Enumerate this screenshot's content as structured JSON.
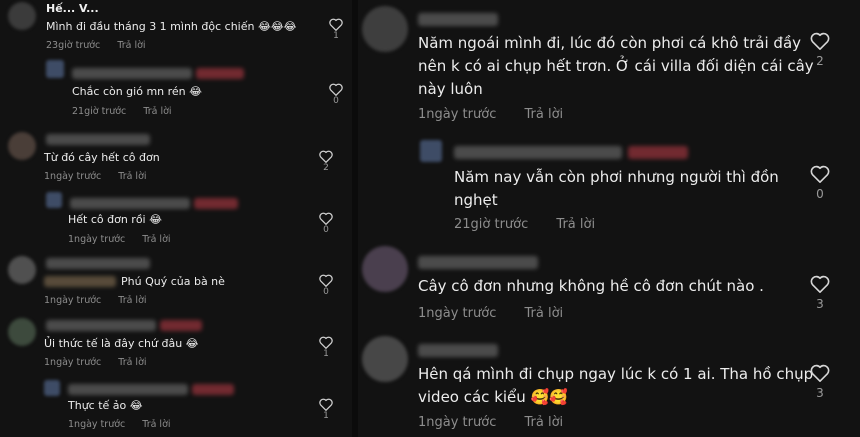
{
  "left": {
    "top_name": "Hế... V...",
    "comments": [
      {
        "text": "Mình đi đầu tháng 3 1 mình độc chiến 😂😂😂",
        "time": "23giờ trước",
        "reply": "Trả lời",
        "likes": "1"
      },
      {
        "text": "Chắc còn gió mn rén 😂",
        "time": "21giờ trước",
        "reply": "Trả lời",
        "likes": "0"
      },
      {
        "text": "Từ đó cây hết cô đơn",
        "time": "1ngày trước",
        "reply": "Trả lời",
        "likes": "2"
      },
      {
        "text": "Hết cô đơn rồi 😂",
        "time": "1ngày trước",
        "reply": "Trả lời",
        "likes": "0"
      },
      {
        "text": "Phú Quý của bà nè",
        "time": "1ngày trước",
        "reply": "Trả lời",
        "likes": "0"
      },
      {
        "text": "Ủi thức tế là đây chứ đâu 😂",
        "time": "1ngày trước",
        "reply": "Trả lời",
        "likes": "1"
      },
      {
        "text": "Thực tế ảo 😂",
        "time": "1ngày trước",
        "reply": "Trả lời",
        "likes": "1"
      }
    ]
  },
  "right": {
    "comments": [
      {
        "line1": "Năm ngoái mình đi, lúc đó còn phơi cá khô trải đầy",
        "line2": "nên k có ai chụp hết trơn. Ở cái villa đối diện cái cây",
        "line3": "này luôn",
        "time": "1ngày trước",
        "reply": "Trả lời",
        "likes": "2"
      },
      {
        "line1": "Năm nay vẫn còn phơi nhưng người thì đồn",
        "line2": "nghẹt",
        "time": "21giờ trước",
        "reply": "Trả lời",
        "likes": "0"
      },
      {
        "line1": "Cây cô đơn nhưng không hề cô đơn chút nào .",
        "time": "1ngày trước",
        "reply": "Trả lời",
        "likes": "3"
      },
      {
        "line1": "Hên qá mình đi chụp ngay lúc k có 1 ai. Tha hồ chụp",
        "line2": "video các kiểu 🥰🥰",
        "time": "1ngày trước",
        "reply": "Trả lời",
        "likes": "3"
      }
    ]
  }
}
